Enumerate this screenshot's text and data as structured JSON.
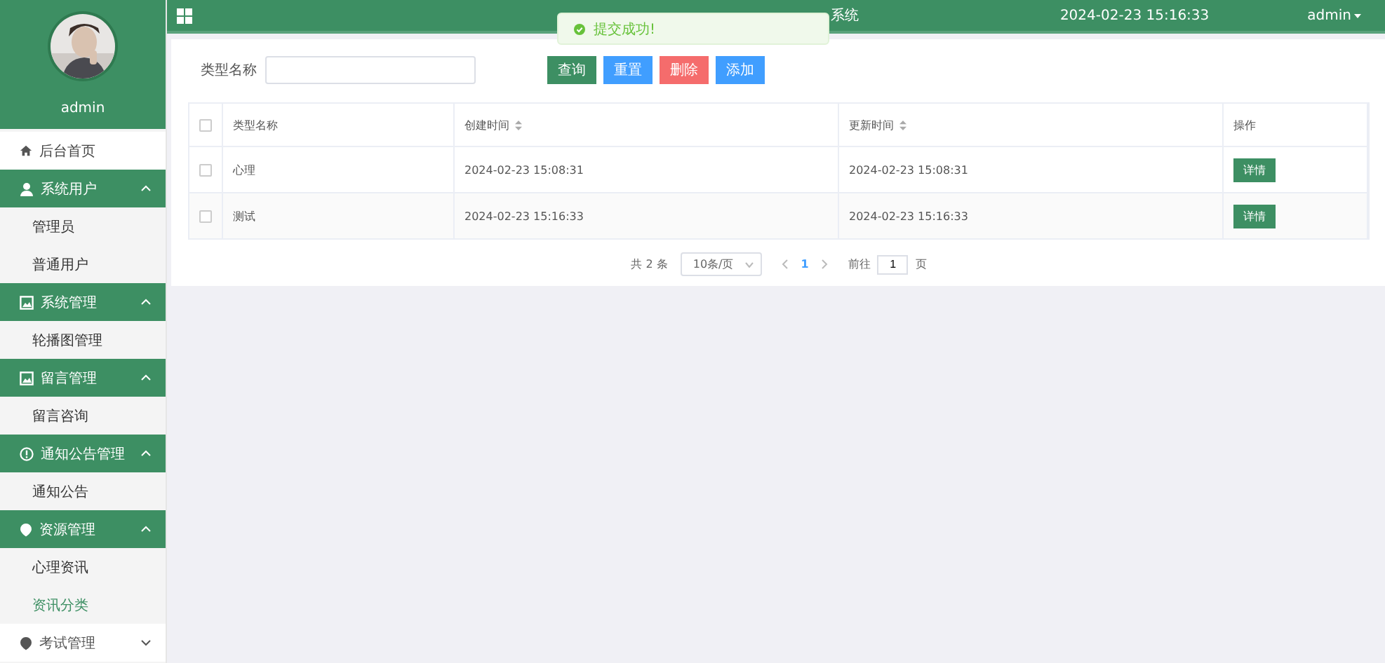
{
  "header": {
    "title": "系统",
    "datetime": "2024-02-23 15:16:33",
    "user": "admin"
  },
  "toast": {
    "text": "提交成功!"
  },
  "sidebar": {
    "username": "admin",
    "items": [
      {
        "kind": "link",
        "label": "后台首页",
        "selected": false
      },
      {
        "kind": "group",
        "label": "系统用户",
        "expanded": true,
        "children": [
          {
            "label": "管理员",
            "selected": false
          },
          {
            "label": "普通用户",
            "selected": false
          }
        ]
      },
      {
        "kind": "group",
        "label": "系统管理",
        "expanded": true,
        "children": [
          {
            "label": "轮播图管理",
            "selected": false
          }
        ]
      },
      {
        "kind": "group",
        "label": "留言管理",
        "expanded": true,
        "children": [
          {
            "label": "留言咨询",
            "selected": false
          }
        ]
      },
      {
        "kind": "group",
        "label": "通知公告管理",
        "expanded": true,
        "children": [
          {
            "label": "通知公告",
            "selected": false
          }
        ]
      },
      {
        "kind": "group",
        "label": "资源管理",
        "expanded": true,
        "children": [
          {
            "label": "心理资讯",
            "selected": false
          },
          {
            "label": "资讯分类",
            "selected": true
          }
        ]
      },
      {
        "kind": "group",
        "label": "考试管理",
        "expanded": false
      }
    ]
  },
  "search": {
    "label": "类型名称"
  },
  "buttons": [
    {
      "label": "查询",
      "kind": "query"
    },
    {
      "label": "重置",
      "kind": "reset"
    },
    {
      "label": "删除",
      "kind": "delete"
    },
    {
      "label": "添加",
      "kind": "add"
    }
  ],
  "table": {
    "header_checked": false,
    "columns": [
      {
        "label": "类型名称",
        "sortable": false
      },
      {
        "label": "创建时间",
        "sortable": true
      },
      {
        "label": "更新时间",
        "sortable": true
      },
      {
        "label": "操作",
        "sortable": false
      }
    ],
    "rows": [
      {
        "checked": false,
        "cells": [
          "心理",
          "2024-02-23 15:08:31",
          "2024-02-23 15:08:31"
        ],
        "action": "详情"
      },
      {
        "checked": false,
        "cells": [
          "测试",
          "2024-02-23 15:16:33",
          "2024-02-23 15:16:33"
        ],
        "action": "详情"
      }
    ]
  },
  "pagination": {
    "total": "共 2 条",
    "page_size": "10条/页",
    "pages": [
      {
        "label": "1",
        "selected": true
      }
    ],
    "goto_label": "前往",
    "goto_value": "1",
    "goto_suffix": "页"
  }
}
